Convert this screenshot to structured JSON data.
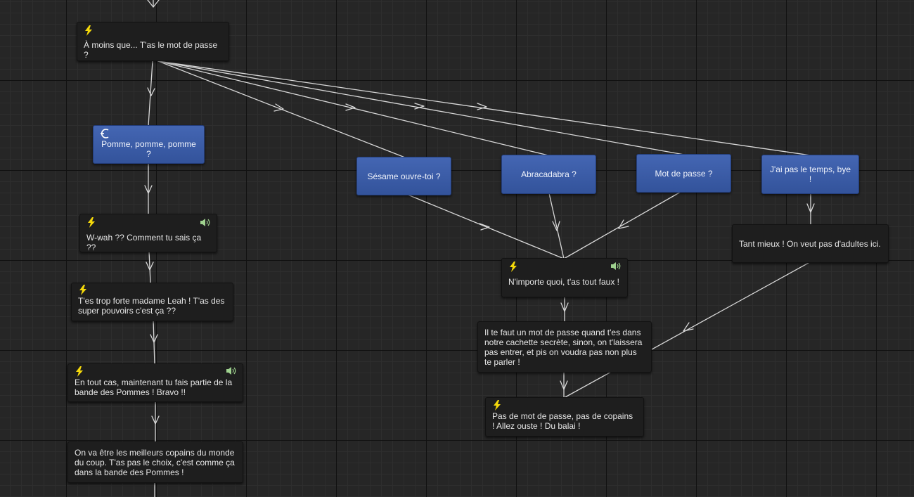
{
  "nodes": {
    "mot_de_passe_question": "À moins que... T'as le mot de passe ?",
    "pomme": "Pomme, pomme, pomme ?",
    "wwah": "W-wah ?? Comment tu sais ça ??",
    "trop_forte": "T'es trop forte madame Leah ! T'as des super pouvoirs c'est ça ??",
    "en_tout_cas": "En tout cas, maintenant tu fais partie de la bande des Pommes ! Bravo !!",
    "meilleurs_copains": "On va être les meilleurs copains du monde du coup. T'as pas le choix, c'est comme ça dans la bande des Pommes !",
    "sesame": "Sésame ouvre-toi ?",
    "abracadabra": "Abracadabra ?",
    "mot_de_passe": "Mot de passe ?",
    "pas_le_temps": "J'ai pas le temps, bye !",
    "tant_mieux": "Tant mieux ! On veut pas d'adultes ici.",
    "nimporte_quoi": "N'importe quoi, t'as tout faux !",
    "il_te_faut": "Il te faut un mot de passe quand t'es dans notre cachette secrète, sinon, on t'laissera pas entrer, et pis on voudra pas non plus te parler !",
    "pas_de_mot": "Pas de mot de passe, pas de copains ! Allez ouste ! Du balai !"
  },
  "colors": {
    "background": "#262626",
    "node": "#1e1e1e",
    "choice_node": "#3d5ca8",
    "wire": "#d8d8d8",
    "event_icon": "#f5d90a",
    "audio_icon": "#9fd28f"
  },
  "icons": {
    "event": "lightning-bolt-icon",
    "audio": "speaker-icon",
    "choice": "branch-swirl-icon"
  }
}
